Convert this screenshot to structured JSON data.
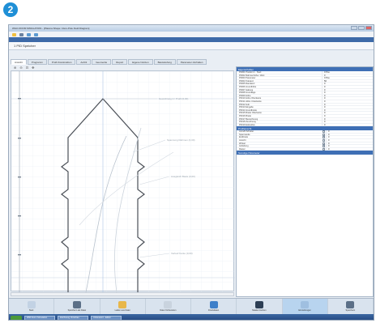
{
  "badge": {
    "number": "2"
  },
  "window": {
    "title": "WILD ZOOM SIMULATION - [Plasma Shape / Zero-Pole Field Diagram]",
    "section_title": "1 PID Speicher"
  },
  "tabs": [
    {
      "label": "Ansicht",
      "active": true
    },
    {
      "label": "Programm",
      "active": false
    },
    {
      "label": "Profil-Konstruktion",
      "active": false
    },
    {
      "label": "Auftrit",
      "active": false
    },
    {
      "label": "Geometrie",
      "active": false
    },
    {
      "label": "Report",
      "active": false
    },
    {
      "label": "Eigene Notizen",
      "active": false
    },
    {
      "label": "Basisstufung",
      "active": false
    },
    {
      "label": "Parameter-Verhalten",
      "active": false
    }
  ],
  "tools": [
    "zoom-in-icon",
    "zoom-out-icon",
    "fit-icon",
    "pan-icon"
  ],
  "properties": {
    "section1": "Eigenschaften",
    "rows1": [
      {
        "k": "P0001 Position 1 - Start",
        "v": "0 Pos"
      },
      {
        "k": "P0002 Rahmenhöhe / Wert",
        "v": "0"
      },
      {
        "k": "P0003 Parameter",
        "v": "0 Pos"
      },
      {
        "k": "P0004 Toleranz",
        "v": "50"
      },
      {
        "k": "P0005 Randwert",
        "v": "0"
      },
      {
        "k": "P0006 Grundhöhe",
        "v": "0"
      },
      {
        "k": "P0007 Haltung",
        "v": "0"
      },
      {
        "k": "P0008 Grundlage",
        "v": "0"
      },
      {
        "k": "P0009 Höhe",
        "v": "0"
      },
      {
        "k": "P0010 Höhe Oberkante",
        "v": "0"
      },
      {
        "k": "P0011 Höhe Unterkante",
        "v": "0"
      },
      {
        "k": "P0012 Hub",
        "v": "0"
      },
      {
        "k": "P0013 Eingabe",
        "v": "0"
      },
      {
        "k": "P0014 Grundbreite",
        "v": "0"
      },
      {
        "k": "P0015 Breite Oberkante",
        "v": "0"
      },
      {
        "k": "P0016 Breite",
        "v": "0"
      },
      {
        "k": "P0017 Bezeichnung",
        "v": "0"
      },
      {
        "k": "P0018 Zuordnung",
        "v": "0"
      },
      {
        "k": "P0019 Eckradius",
        "v": "0"
      }
    ],
    "section2": "Profilansicht",
    "rows2": [
      {
        "k": "Anzahl Schalter",
        "v": "0"
      },
      {
        "k": "Spannweite",
        "v": "0"
      },
      {
        "k": "Endbreite",
        "v": "0"
      },
      {
        "k": "Ansicht",
        "v": "0"
      },
      {
        "k": "Winkel",
        "v": "0"
      },
      {
        "k": "Aufteilung",
        "v": "0"
      },
      {
        "k": "Raster",
        "v": "0"
      }
    ],
    "section3": "Sonstige Parameter"
  },
  "actions": [
    {
      "label": "Start",
      "icon": "disc-icon",
      "color": "#c2d2e4",
      "selected": false
    },
    {
      "label": "Speichern als Datei",
      "icon": "save-icon",
      "color": "#5b6f87",
      "selected": false
    },
    {
      "label": "Laden aus Datei",
      "icon": "folder-icon",
      "color": "#e8b74a",
      "selected": false
    },
    {
      "label": "Datei Vorbereiten",
      "icon": "clock-icon",
      "color": "#c9d3de",
      "selected": false
    },
    {
      "label": "Druckdaten",
      "icon": "print-icon",
      "color": "#3d7fc9",
      "selected": false
    },
    {
      "label": "Maske löschen",
      "icon": "record-icon",
      "color": "#2c3e54",
      "selected": false
    },
    {
      "label": "Einstellungen",
      "icon": "settings-icon",
      "color": "#9fbfe0",
      "selected": true
    },
    {
      "label": "Speichern",
      "icon": "save-icon",
      "color": "#5b6f87",
      "selected": false
    }
  ],
  "taskbar": {
    "items": [
      "Wild Zoom Simulation",
      "Zeichnung Vorschau",
      "Unbenannt - Editor"
    ]
  },
  "chart_annotations": [
    "Gewichtung 1 / Profil (0,00)",
    "Spannung Rahmen (0,00)",
    "Ausgleich Basis (0,00)",
    "Verlauf Kante (0,00)"
  ]
}
